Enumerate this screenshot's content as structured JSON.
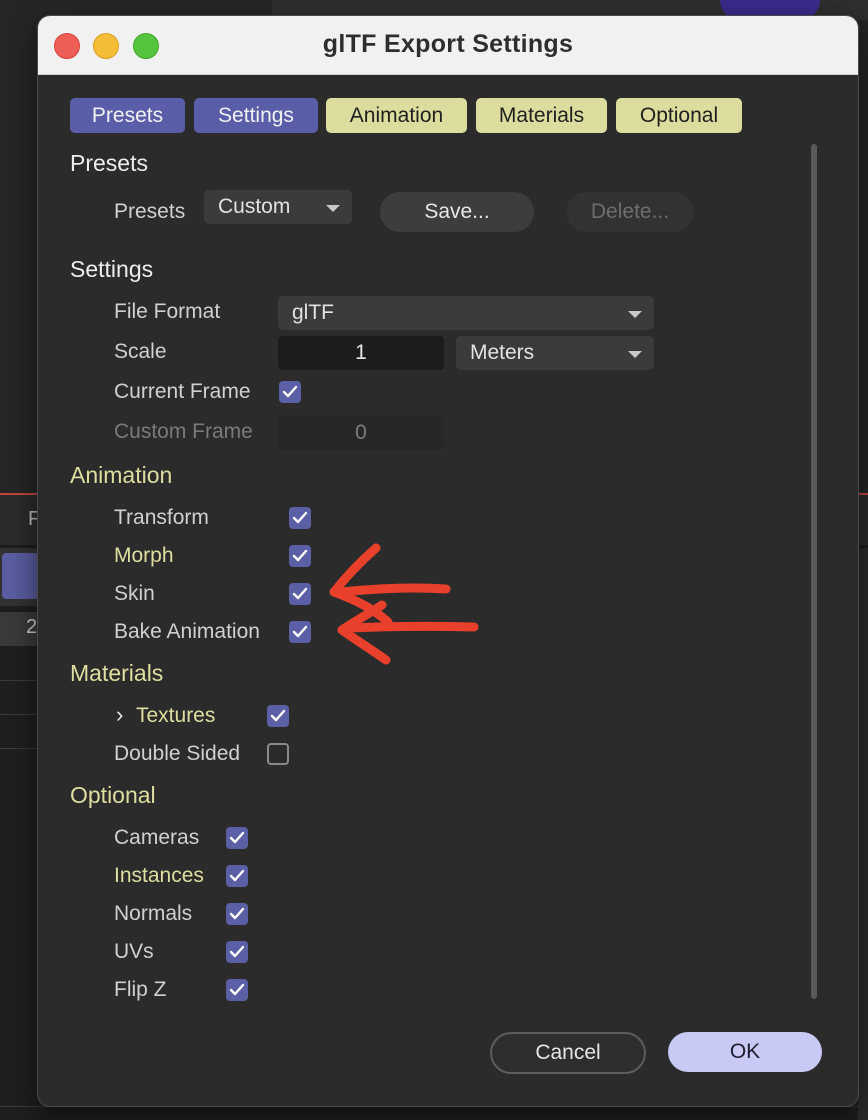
{
  "window": {
    "title": "glTF Export Settings"
  },
  "background": {
    "ruler_text": "2",
    "strip_text": "F"
  },
  "tabs": [
    {
      "label": "Presets",
      "style": "blue"
    },
    {
      "label": "Settings",
      "style": "blue"
    },
    {
      "label": "Animation",
      "style": "yellow"
    },
    {
      "label": "Materials",
      "style": "yellow"
    },
    {
      "label": "Optional",
      "style": "yellow"
    }
  ],
  "presets": {
    "section_title": "Presets",
    "label": "Presets",
    "selected": "Custom",
    "save_label": "Save...",
    "delete_label": "Delete..."
  },
  "settings": {
    "section_title": "Settings",
    "file_format_label": "File Format",
    "file_format_value": "glTF",
    "scale_label": "Scale",
    "scale_value": "1",
    "scale_unit": "Meters",
    "current_frame_label": "Current Frame",
    "current_frame_checked": true,
    "custom_frame_label": "Custom Frame",
    "custom_frame_value": "0"
  },
  "animation": {
    "section_title": "Animation",
    "transform_label": "Transform",
    "morph_label": "Morph",
    "skin_label": "Skin",
    "bake_label": "Bake Animation"
  },
  "materials": {
    "section_title": "Materials",
    "textures_label": "Textures",
    "double_sided_label": "Double Sided"
  },
  "optional": {
    "section_title": "Optional",
    "cameras_label": "Cameras",
    "instances_label": "Instances",
    "normals_label": "Normals",
    "uvs_label": "UVs",
    "flipz_label": "Flip Z"
  },
  "footer": {
    "cancel_label": "Cancel",
    "ok_label": "OK"
  },
  "colors": {
    "accent_blue": "#5a5ea8",
    "tab_yellow": "#dbdc9e",
    "section_yellow": "#dedea0",
    "annotation_red": "#e8402b",
    "ok_button": "#c9c9f5"
  }
}
